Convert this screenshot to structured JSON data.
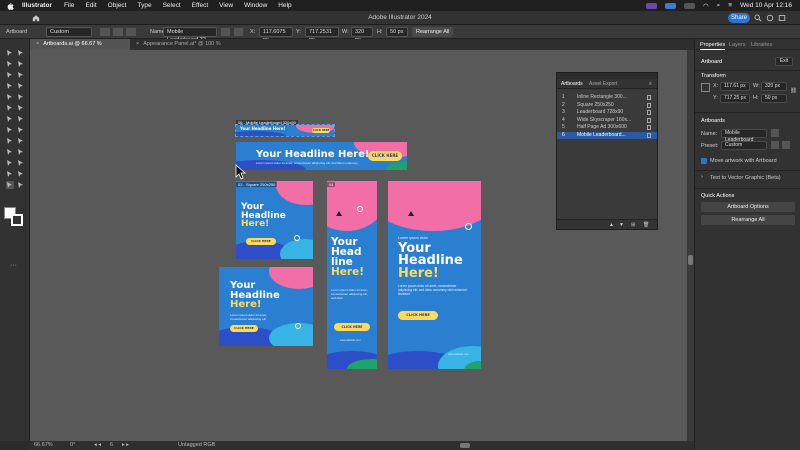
{
  "menubar": {
    "app_name": "Illustrator",
    "items": [
      "File",
      "Edit",
      "Object",
      "Type",
      "Select",
      "Effect",
      "View",
      "Window",
      "Help"
    ],
    "datetime": "Wed 10 Apr  12:16"
  },
  "titlebar": {
    "title": "Adobe Illustrator 2024",
    "share_label": "Share"
  },
  "controlbar": {
    "artboard_label": "Artboard",
    "preset_value": "Custom",
    "name_label": "Name:",
    "name_value": "Mobile Leaderboard 32",
    "x_label": "X:",
    "x_value": "117.6075 px",
    "y_label": "Y:",
    "y_value": "717.2531 px",
    "w_label": "W:",
    "w_value": "320 px",
    "h_label": "H:",
    "h_value": "50 px",
    "rearrange_label": "Rearrange All"
  },
  "tabs": [
    {
      "label": "Artboards.ai @ 66.67 % (RGB/Preview)",
      "active": true
    },
    {
      "label": "Appearance Panel.ai* @ 100 % (RGB/Preview)",
      "active": false
    }
  ],
  "status": {
    "zoom": "66.67%",
    "rotation": "0°",
    "artboard_num": "6",
    "color_mode": "Untagged RGB"
  },
  "artboards": {
    "mobile": {
      "label": "06 - Mobile Leaderboard 320x50",
      "headline": "Your Headline Here!",
      "cta": "CLICK HERE"
    },
    "leaderboard": {
      "label": "03 - Leaderboard 728x90",
      "headline": "Your Headline Here!",
      "sub": "Lorem ipsum dolor sit amet, consectetuer adipiscing elit, sed diam nonummy",
      "cta": "CLICK HERE"
    },
    "square": {
      "label": "02 - Square 250x250",
      "headline1": "Your",
      "headline2": "Headline",
      "headline3": "Here!",
      "cta": "CLICK HERE"
    },
    "inline": {
      "label": "01 - Inline Rectangle 300x250",
      "headline1": "Your",
      "headline2": "Headline",
      "headline3": "Here!",
      "sub": "Lorem ipsum dolor sit amet, consectetuer adipiscing elit",
      "cta": "CLICK HERE"
    },
    "skyscraper": {
      "label": "04",
      "headline1": "Your",
      "headline2": "Head",
      "headline3": "line",
      "headline4": "Here!",
      "sub": "Lorem ipsum dolor sit amet, consectetuer adipiscing elit, sed diam",
      "cta": "CLICK HERE",
      "url": "www.website.com"
    },
    "halfpage": {
      "label": "05 - Half Page Ad 300x600",
      "tagline": "Lorem ipsum dolor",
      "headline1": "Your",
      "headline2": "Headline",
      "headline3": "Here!",
      "sub": "Lorem ipsum dolor sit amet, consectetuer adipiscing elit, sed diam nonummy nibh euismod tincidunt",
      "cta": "CLICK HERE",
      "url": "www.website.com"
    }
  },
  "abpanel": {
    "tab_artboards": "Artboards",
    "tab_asset_export": "Asset Export",
    "rows": [
      {
        "num": "1",
        "name": "Inline Rectangle 300..."
      },
      {
        "num": "2",
        "name": "Square 250x250"
      },
      {
        "num": "3",
        "name": "Leaderboard 728x90"
      },
      {
        "num": "4",
        "name": "Wide Skyscraper 160x..."
      },
      {
        "num": "5",
        "name": "Half Page Ad 300x600"
      },
      {
        "num": "6",
        "name": "Mobile Leaderboard..."
      }
    ],
    "selected_index": 5
  },
  "rpanel": {
    "tab_properties": "Properties",
    "tab_layers": "Layers",
    "tab_libraries": "Libraries",
    "section_artboard": "Artboard",
    "exit_label": "Exit",
    "section_transform": "Transform",
    "x_label": "X:",
    "x_value": "117.61 px",
    "y_label": "Y:",
    "y_value": "717.25 px",
    "w_label": "W:",
    "w_value": "320 px",
    "h_label": "H:",
    "h_value": "50 px",
    "section_artboards": "Artboards",
    "name_label": "Name:",
    "name_value": "Mobile Leaderboard",
    "preset_label": "Preset:",
    "preset_value": "Custom",
    "move_artwork_label": "Move artwork with Artboard",
    "text_to_vector": "Text to Vector Graphic (Beta)",
    "section_quick_actions": "Quick Actions",
    "artboard_options_label": "Artboard Options",
    "rearrange_all_label": "Rearrange All"
  },
  "colors": {
    "accent_blue": "#2c73d2",
    "ad_blue": "#2a7fd0",
    "ad_pink": "#f26ea6",
    "ad_yellow": "#ffd95a",
    "ad_green": "#1ea36a"
  }
}
